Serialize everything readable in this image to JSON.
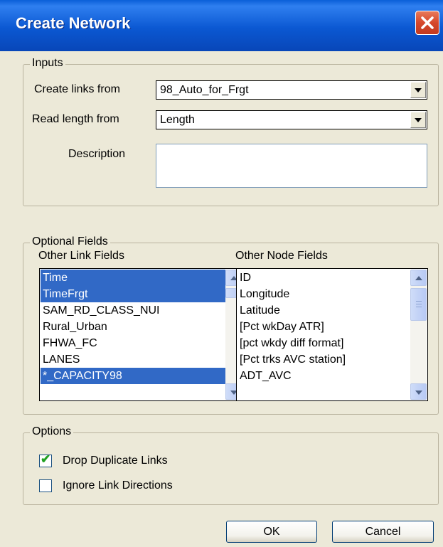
{
  "window": {
    "title": "Create Network",
    "close_icon": "close-icon"
  },
  "inputs": {
    "legend": "Inputs",
    "create_links_label": "Create links from",
    "create_links_value": "98_Auto_for_Frgt",
    "read_length_label": "Read length from",
    "read_length_value": "Length",
    "description_label": "Description",
    "description_value": ""
  },
  "optional_fields": {
    "legend": "Optional Fields",
    "link_fields_header": "Other Link Fields",
    "link_fields": [
      {
        "label": "Time",
        "selected": true
      },
      {
        "label": "TimeFrgt",
        "selected": true
      },
      {
        "label": "SAM_RD_CLASS_NUI",
        "selected": false
      },
      {
        "label": "Rural_Urban",
        "selected": false
      },
      {
        "label": "FHWA_FC",
        "selected": false
      },
      {
        "label": "LANES",
        "selected": false
      },
      {
        "label": "*_CAPACITY98",
        "selected": true
      }
    ],
    "node_fields_header": "Other Node Fields",
    "node_fields": [
      {
        "label": "ID",
        "selected": false
      },
      {
        "label": "Longitude",
        "selected": false
      },
      {
        "label": "Latitude",
        "selected": false
      },
      {
        "label": "[Pct wkDay ATR]",
        "selected": false
      },
      {
        "label": "[pct wkdy diff format]",
        "selected": false
      },
      {
        "label": "[Pct trks AVC station]",
        "selected": false
      },
      {
        "label": "ADT_AVC",
        "selected": false
      }
    ]
  },
  "options": {
    "legend": "Options",
    "drop_duplicates_label": "Drop Duplicate Links",
    "drop_duplicates_checked": true,
    "ignore_directions_label": "Ignore Link Directions",
    "ignore_directions_checked": false
  },
  "buttons": {
    "ok": "OK",
    "cancel": "Cancel"
  },
  "colors": {
    "title_bar": "#0b58d2",
    "selection": "#3169c6",
    "dialog_bg": "#ece9d8"
  }
}
